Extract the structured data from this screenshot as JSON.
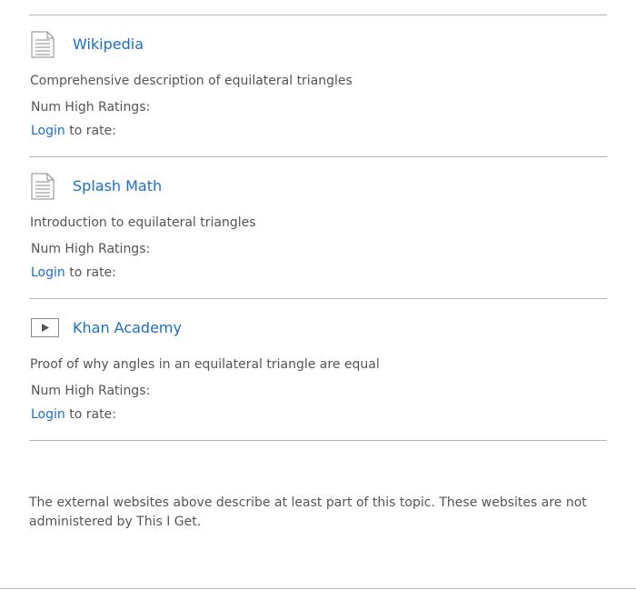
{
  "resources": [
    {
      "icon": "document-icon",
      "title": "Wikipedia",
      "description": "Comprehensive description of equilateral triangles",
      "ratings_label": "Num High Ratings:",
      "login_label": "Login",
      "rate_suffix": " to rate:"
    },
    {
      "icon": "document-icon",
      "title": "Splash Math",
      "description": "Introduction to equilateral triangles",
      "ratings_label": "Num High Ratings:",
      "login_label": "Login",
      "rate_suffix": " to rate:"
    },
    {
      "icon": "video-play-icon",
      "title": "Khan Academy",
      "description": "Proof of why angles in an equilateral triangle are equal",
      "ratings_label": "Num High Ratings:",
      "login_label": "Login",
      "rate_suffix": " to rate:"
    }
  ],
  "footer": {
    "disclaimer": "The external websites above describe at least part of this topic. These websites are not administered by This I Get."
  },
  "colors": {
    "link": "#1a6fc9",
    "text": "#555555",
    "divider": "#b4b4b4"
  }
}
